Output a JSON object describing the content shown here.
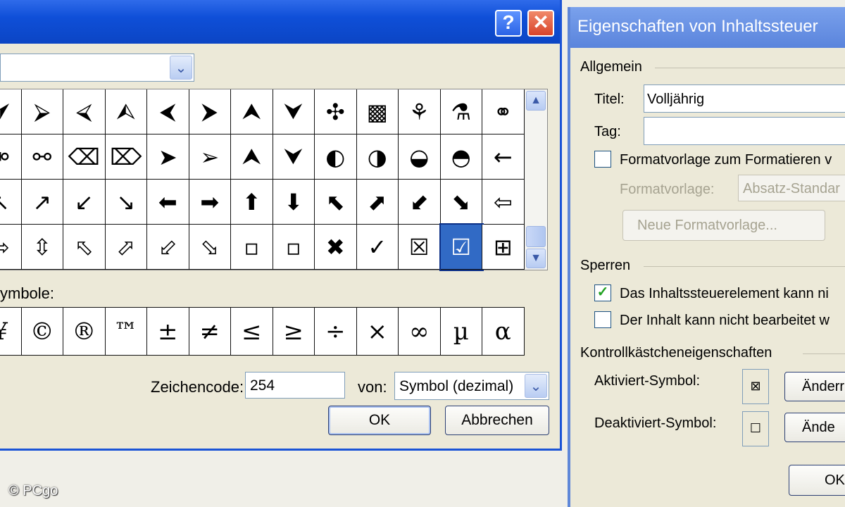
{
  "symbol_dialog": {
    "help_glyph": "?",
    "close_glyph": "✕",
    "dropdown_glyph": "⌄",
    "scroll_up_glyph": "▲",
    "scroll_down_glyph": "▼",
    "symbols": [
      [
        "⮛",
        "⮚",
        "⮘",
        "⮙",
        "⮜",
        "⮞",
        "⮝",
        "⮟",
        "✣",
        "▩",
        "⚘",
        "⚗",
        "⚭"
      ],
      [
        "⚮",
        "⚯",
        "⌫",
        "⌦",
        "➤",
        "➢",
        "⮝",
        "⮟",
        "◐",
        "◑",
        "◒",
        "◓",
        "←"
      ],
      [
        "↖",
        "↗",
        "↙",
        "↘",
        "⬅",
        "➡",
        "⬆",
        "⬇",
        "⬉",
        "⬈",
        "⬋",
        "⬊",
        "⇦"
      ],
      [
        "⇨",
        "⇳",
        "⬁",
        "⬀",
        "⬃",
        "⬂",
        "▫",
        "▫",
        "✖",
        "✓",
        "☒",
        "☑",
        "⊞"
      ]
    ],
    "selected_row": 3,
    "selected_col": 11,
    "recent_label": "ymbole:",
    "recent_symbols": [
      "¥",
      "©",
      "®",
      "™",
      "±",
      "≠",
      "≤",
      "≥",
      "÷",
      "×",
      "∞",
      "µ",
      "α"
    ],
    "charcode_label": "Zeichencode:",
    "charcode_value": "254",
    "from_label": "von:",
    "from_value": "Symbol (dezimal)",
    "ok_label": "OK",
    "cancel_label": "Abbrechen"
  },
  "copyright": "© PCgo",
  "props_dialog": {
    "title": "Eigenschaften von Inhaltssteuer",
    "general_label": "Allgemein",
    "title_label": "Titel:",
    "title_value": "Volljährig",
    "tag_label": "Tag:",
    "tag_value": "",
    "format_check_label": "Formatvorlage zum Formatieren v",
    "format_style_label": "Formatvorlage:",
    "format_style_value": "Absatz-Standar",
    "new_style_label": "Neue Formatvorlage...",
    "lock_label": "Sperren",
    "lock1_label": "Das Inhaltssteuerelement kann ni",
    "lock1_checked": true,
    "lock2_label": "Der Inhalt kann nicht bearbeitet w",
    "lock2_checked": false,
    "checkbox_props_label": "Kontrollkästcheneigenschaften",
    "checked_symbol_label": "Aktiviert-Symbol:",
    "checked_symbol": "⊠",
    "unchecked_symbol_label": "Deaktiviert-Symbol:",
    "unchecked_symbol": "☐",
    "change_label_1": "Änderr",
    "change_label_2": "Ände",
    "ok_label": "OK",
    "check_glyph": "✓"
  }
}
